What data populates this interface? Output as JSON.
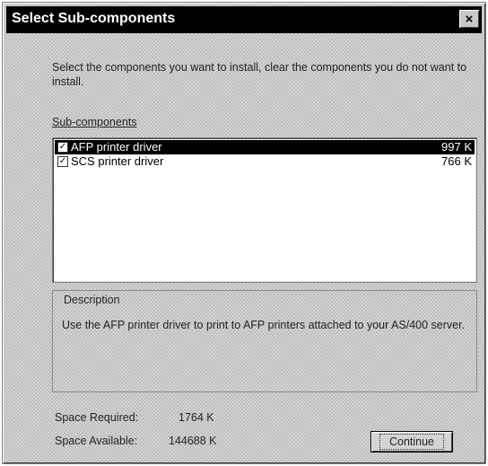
{
  "window": {
    "title": "Select Sub-components",
    "close_label": "×"
  },
  "instruction": "Select the components you want to install, clear the components you do not want to install.",
  "subcomponents": {
    "label": "Sub-components",
    "items": [
      {
        "name": "AFP printer driver",
        "size": "997 K",
        "checked": true,
        "selected": true
      },
      {
        "name": "SCS printer driver",
        "size": "766 K",
        "checked": true,
        "selected": false
      }
    ]
  },
  "description": {
    "title": "Description",
    "text": "Use the AFP printer driver to print to AFP printers attached to your AS/400 server."
  },
  "space": {
    "required_label": "Space Required:",
    "required_value": "1764 K",
    "available_label": "Space Available:",
    "available_value": "144688 K"
  },
  "buttons": {
    "continue_label": "Continue"
  },
  "colors": {
    "titlebar": "#000000",
    "selection": "#000000",
    "face": "#d4d4d4"
  },
  "icons": {
    "close": "close-icon",
    "checkbox": "checkmark-icon"
  }
}
